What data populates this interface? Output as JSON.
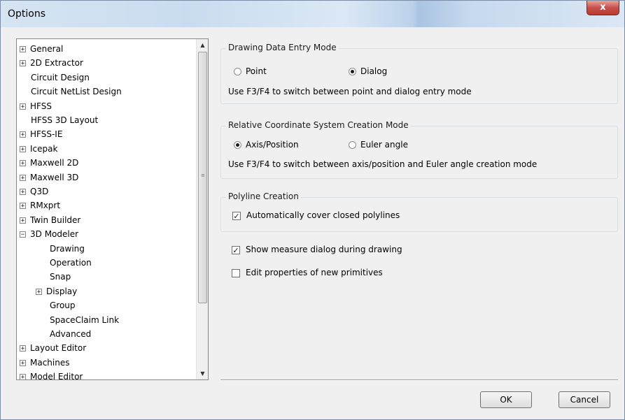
{
  "window": {
    "title": "Options",
    "close_glyph": "x"
  },
  "tree": {
    "items": [
      {
        "label": "General",
        "expander": "+"
      },
      {
        "label": "2D Extractor",
        "expander": "+"
      },
      {
        "label": "Circuit Design",
        "expander": ""
      },
      {
        "label": "Circuit NetList Design",
        "expander": ""
      },
      {
        "label": "HFSS",
        "expander": "+"
      },
      {
        "label": "HFSS 3D Layout",
        "expander": ""
      },
      {
        "label": "HFSS-IE",
        "expander": "+"
      },
      {
        "label": "Icepak",
        "expander": "+"
      },
      {
        "label": "Maxwell 2D",
        "expander": "+"
      },
      {
        "label": "Maxwell 3D",
        "expander": "+"
      },
      {
        "label": "Q3D",
        "expander": "+"
      },
      {
        "label": "RMxprt",
        "expander": "+"
      },
      {
        "label": "Twin Builder",
        "expander": "+"
      },
      {
        "label": "3D Modeler",
        "expander": "−"
      },
      {
        "label": "Drawing",
        "expander": "",
        "selected": true
      },
      {
        "label": "Operation",
        "expander": ""
      },
      {
        "label": "Snap",
        "expander": ""
      },
      {
        "label": "Display",
        "expander": "+"
      },
      {
        "label": "Group",
        "expander": ""
      },
      {
        "label": "SpaceClaim Link",
        "expander": ""
      },
      {
        "label": "Advanced",
        "expander": ""
      },
      {
        "label": "Layout Editor",
        "expander": "+"
      },
      {
        "label": "Machines",
        "expander": "+"
      },
      {
        "label": "Model Editor",
        "expander": "+"
      }
    ],
    "scroll_up_glyph": "▲",
    "scroll_down_glyph": "▼",
    "grip_glyph": "≡"
  },
  "drawing_entry": {
    "legend": "Drawing Data Entry Mode",
    "option_point": "Point",
    "option_dialog": "Dialog",
    "selected": "Dialog",
    "hint": "Use F3/F4 to switch between point and dialog entry mode"
  },
  "relative_cs": {
    "legend": "Relative Coordinate System Creation Mode",
    "option_axis": "Axis/Position",
    "option_euler": "Euler angle",
    "selected": "Axis/Position",
    "hint": "Use F3/F4 to switch between axis/position and Euler angle creation mode"
  },
  "polyline": {
    "legend": "Polyline Creation",
    "auto_cover_label": "Automatically cover closed polylines",
    "auto_cover_checked": true
  },
  "show_measure": {
    "label": "Show measure dialog during drawing",
    "checked": true
  },
  "edit_props": {
    "label": "Edit properties of new primitives",
    "checked": false
  },
  "buttons": {
    "ok": "OK",
    "cancel": "Cancel"
  }
}
